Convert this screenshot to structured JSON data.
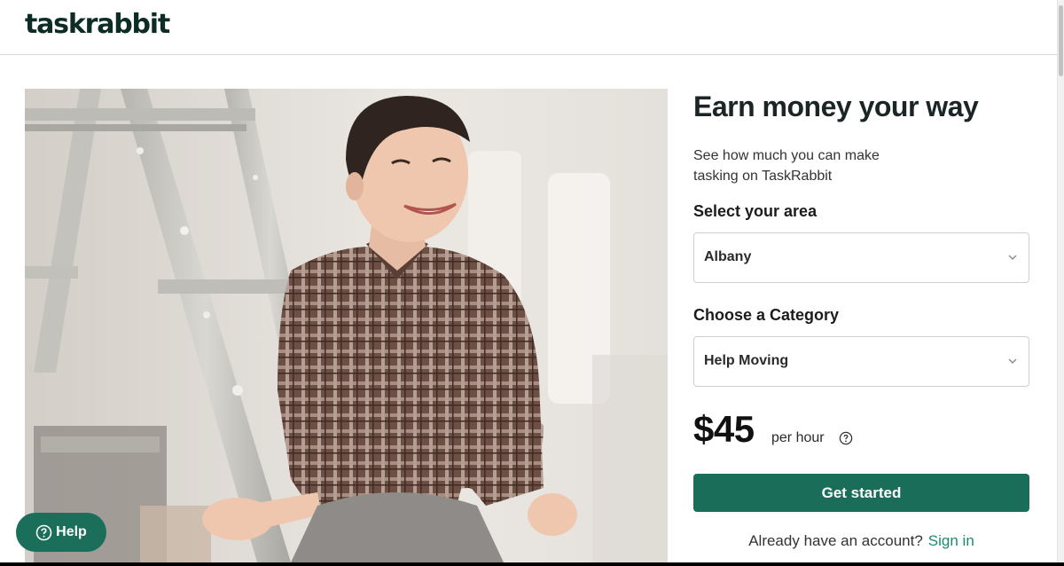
{
  "header": {
    "logo_text": "taskrabbit"
  },
  "hero": {
    "image_alt": "Smiling person in a plaid shirt sitting beside a paint-splattered ladder"
  },
  "form": {
    "title": "Earn money your way",
    "subtitle": "See how much you can make tasking on TaskRabbit",
    "area_label": "Select your area",
    "area_value": "Albany",
    "category_label": "Choose a Category",
    "category_value": "Help Moving",
    "price": "$45",
    "price_unit": "per hour",
    "cta_label": "Get started",
    "account_prompt": "Already have an account?",
    "signin_label": "Sign in"
  },
  "help": {
    "label": "Help"
  },
  "colors": {
    "brand_green": "#1a6e59",
    "link_green": "#1d8a70",
    "logo": "#0d2c26"
  },
  "icons": {
    "chevron": "chevron-down-icon",
    "info": "question-circle-icon",
    "help": "question-circle-icon"
  }
}
